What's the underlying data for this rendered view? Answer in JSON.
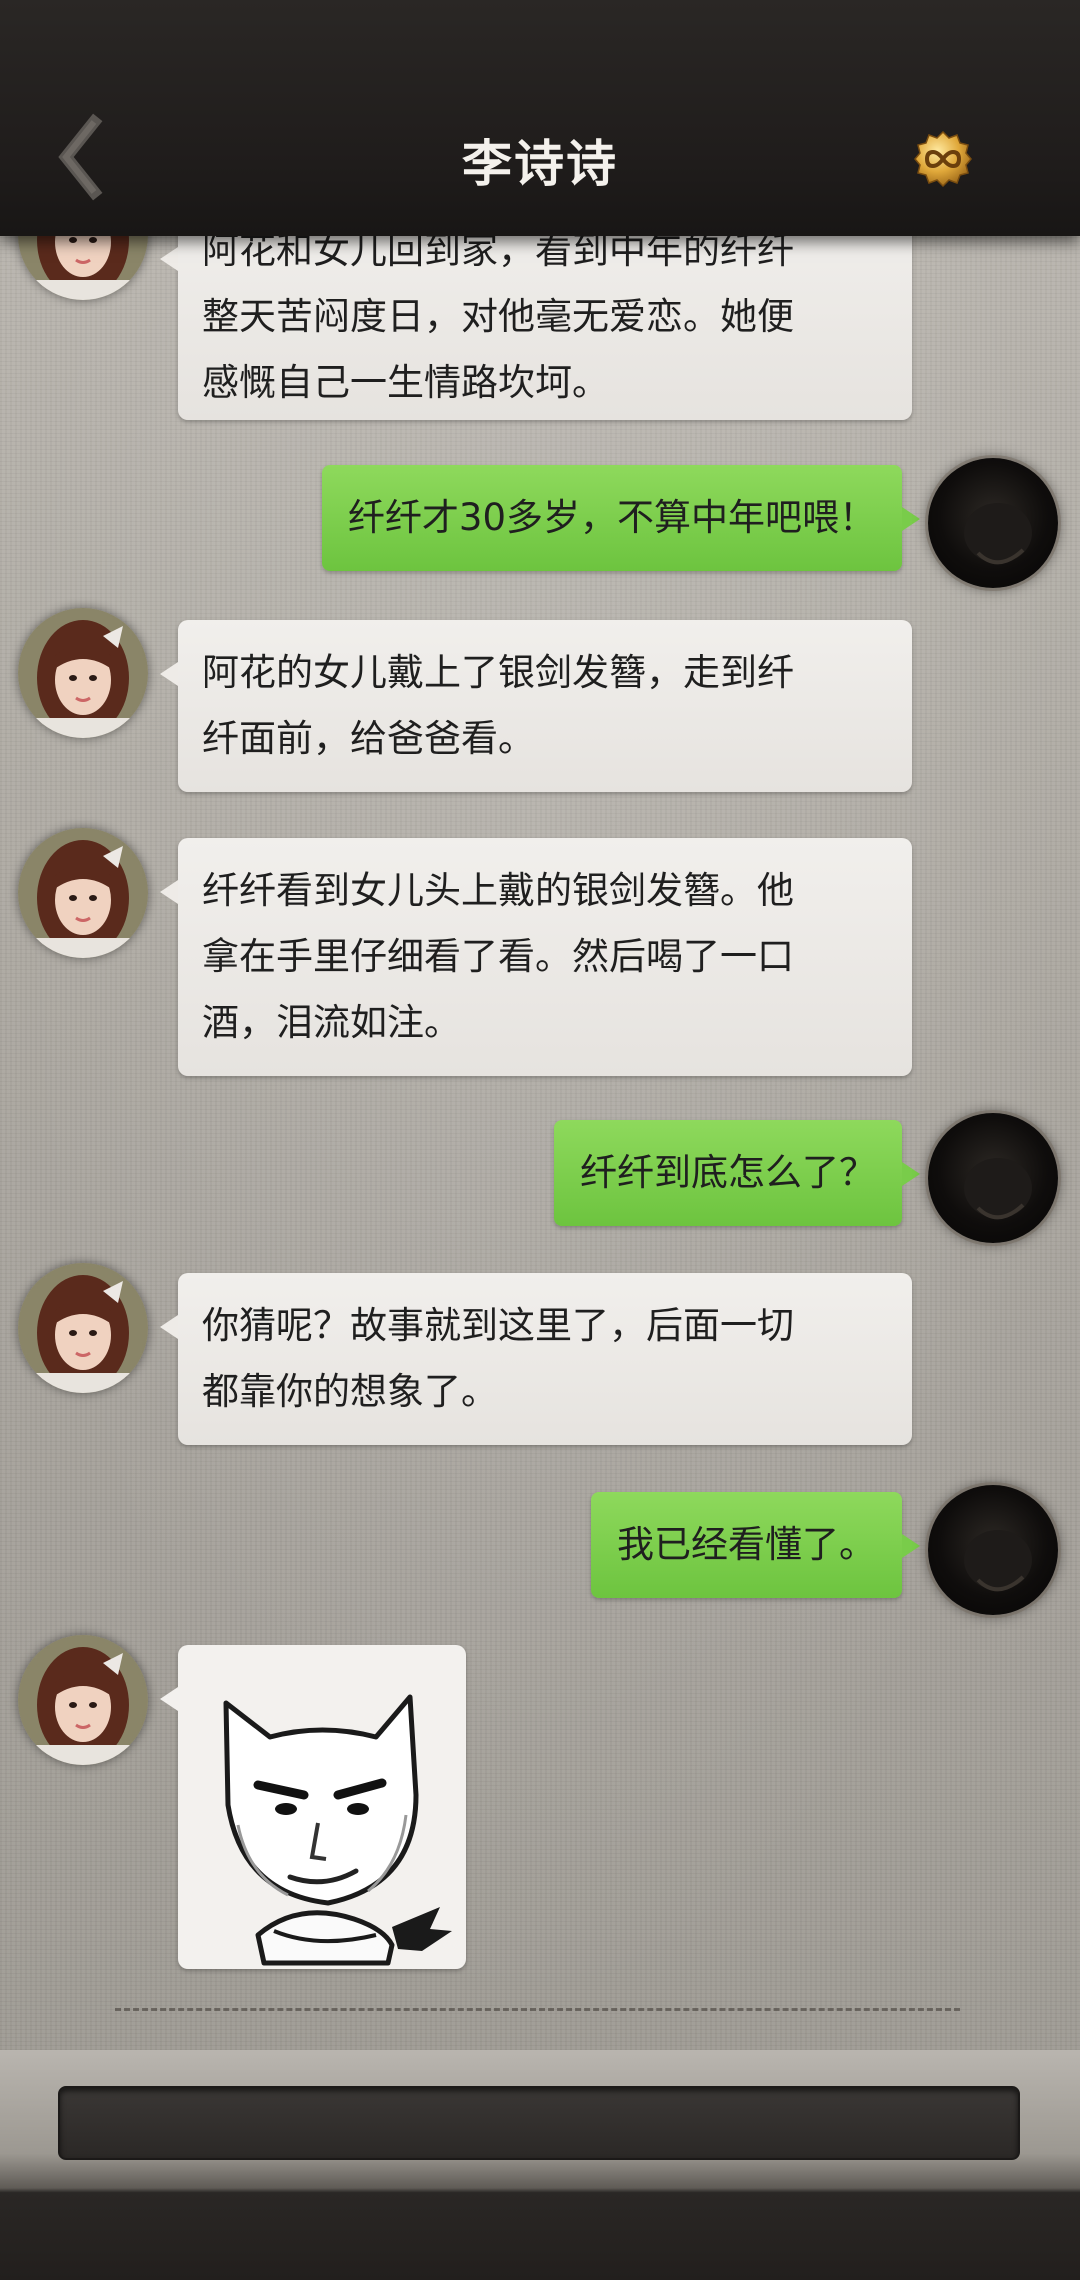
{
  "header": {
    "title": "李诗诗",
    "back_icon": "chevron-left-icon",
    "right_icon": "infinity-medal-icon"
  },
  "messages": [
    {
      "side": "left",
      "lines": [
        "阿花和女儿回到家，看到中年的纤纤",
        "整天苦闷度日，对他毫无爱恋。她便",
        "感慨自己一生情路坎坷。"
      ]
    },
    {
      "side": "right",
      "text": "纤纤才30多岁，不算中年吧喂！"
    },
    {
      "side": "left",
      "lines": [
        "阿花的女儿戴上了银剑发簪，走到纤",
        "纤面前，给爸爸看。"
      ]
    },
    {
      "side": "left",
      "lines": [
        "纤纤看到女儿头上戴的银剑发簪。他",
        "拿在手里仔细看了看。然后喝了一口",
        "酒，泪流如注。"
      ]
    },
    {
      "side": "right",
      "text": "纤纤到底怎么了？"
    },
    {
      "side": "left",
      "lines": [
        "你猜呢？故事就到这里了，后面一切",
        "都靠你的想象了。"
      ]
    },
    {
      "side": "right",
      "text": "我已经看懂了。"
    },
    {
      "side": "left",
      "sticker": "smug-cat-meme-sticker"
    }
  ],
  "input": {
    "value": "",
    "placeholder": ""
  },
  "colors": {
    "header_bg": "#1f1c1b",
    "left_bubble": "#eeebe7",
    "right_bubble": "#79cc4a",
    "background": "#aaa69f"
  }
}
